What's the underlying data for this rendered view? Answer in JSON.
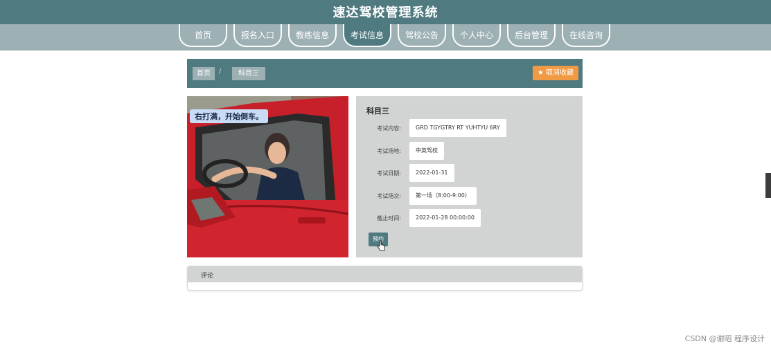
{
  "app": {
    "title": "速达驾校管理系统"
  },
  "nav": {
    "items": [
      {
        "label": "首页"
      },
      {
        "label": "报名入口"
      },
      {
        "label": "教练信息"
      },
      {
        "label": "考试信息"
      },
      {
        "label": "驾校公告"
      },
      {
        "label": "个人中心"
      },
      {
        "label": "后台管理"
      },
      {
        "label": "在线咨询"
      }
    ],
    "active_index": 3
  },
  "breadcrumb": {
    "home": "首页",
    "separator": "/",
    "current": "科目三"
  },
  "favorite": {
    "label": "取消收藏",
    "icon": "star-icon"
  },
  "photo": {
    "caption": "右打满，开始倒车。"
  },
  "details": {
    "title": "科目三",
    "rows": [
      {
        "label": "考试内容:",
        "value": "GRD TGYGTRY RT YUHTYU 6RY"
      },
      {
        "label": "考试场地:",
        "value": "中英驾校"
      },
      {
        "label": "考试日期:",
        "value": "2022-01-31"
      },
      {
        "label": "考试场次:",
        "value": "第一场（8:00-9:00）"
      },
      {
        "label": "截止时间:",
        "value": "2022-01-28 00:00:00"
      }
    ],
    "book_label": "预约"
  },
  "comments": {
    "title": "评论"
  },
  "watermark": "CSDN @谢昭  程序设计",
  "colors": {
    "primary": "#4f7a80",
    "nav": "#9db0b4",
    "accent": "#f09a44",
    "panel": "#d2d4d4"
  }
}
